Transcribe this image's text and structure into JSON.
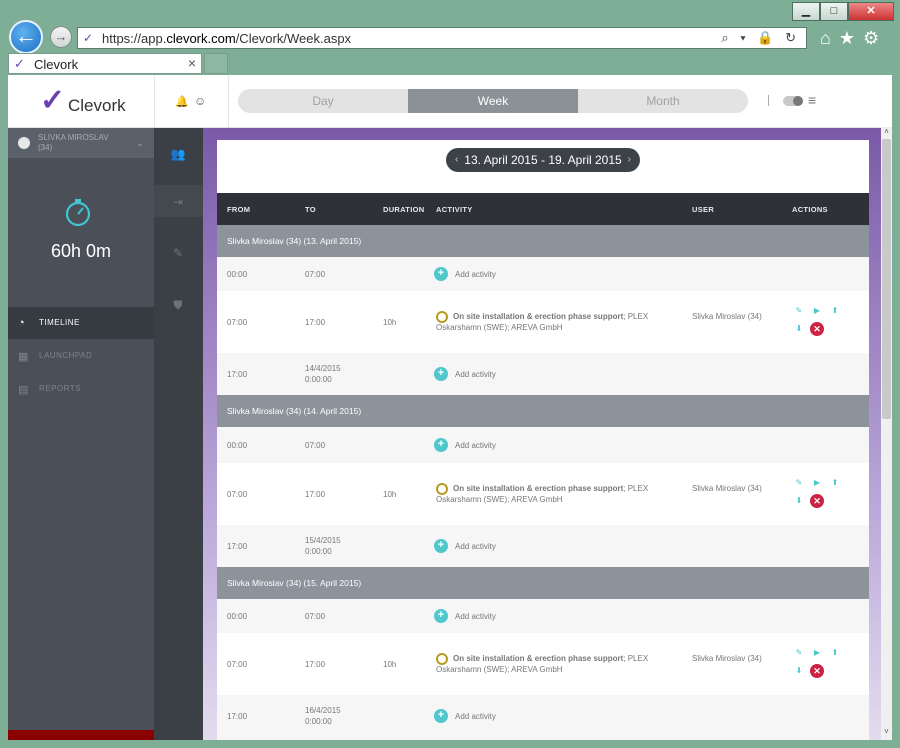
{
  "window": {
    "min": "▁",
    "max": "□",
    "close": "✕"
  },
  "browser": {
    "url_prefix": "https://app.",
    "url_domain": "clevork.com",
    "url_path": "/Clevork/Week.aspx",
    "tools": "⌕ ▾ 🔒 ↻",
    "icons": "⌂★⚙",
    "back": "←",
    "forward": "→"
  },
  "tab": {
    "title": "Clevork",
    "close": "×"
  },
  "header": {
    "logo_text": "Clevork",
    "logo_mark": "✓",
    "bell": "🔔",
    "smile": "☺",
    "views": [
      "Day",
      "Week",
      "Month"
    ],
    "active_view": "Week",
    "menu": "≡"
  },
  "sidebar": {
    "user_name": "SLIVKA MIROSLAV",
    "user_id": "(34)",
    "timer": "60h 0m",
    "nav": [
      {
        "label": "TIMELINE",
        "icon": "timeline-icon",
        "active": true
      },
      {
        "label": "LAUNCHPAD",
        "icon": "launchpad-icon",
        "active": false
      },
      {
        "label": "REPORTS",
        "icon": "reports-icon",
        "active": false
      }
    ]
  },
  "main": {
    "date_range": "13. April 2015 - 19. April 2015",
    "prev": "‹",
    "next": "›",
    "columns": {
      "from": "FROM",
      "to": "TO",
      "duration": "DURATION",
      "activity": "ACTIVITY",
      "user": "USER",
      "actions": "ACTIONS"
    },
    "groups": [
      {
        "title": "Slivka Miroslav (34) (13. April 2015)",
        "r1": {
          "from": "00:00",
          "to": "07:00",
          "add": "Add activity"
        },
        "r2": {
          "from": "07:00",
          "to": "17:00",
          "duration": "10h",
          "activity_bold": "On site installation & erection phase support",
          "activity_rest": "; PLEX Oskarshamn (SWE); AREVA GmbH",
          "user": "Slivka Miroslav (34)"
        },
        "r3": {
          "from": "17:00",
          "to": "14/4/2015 0:00:00",
          "add": "Add activity"
        }
      },
      {
        "title": "Slivka Miroslav (34) (14. April 2015)",
        "r1": {
          "from": "00:00",
          "to": "07:00",
          "add": "Add activity"
        },
        "r2": {
          "from": "07:00",
          "to": "17:00",
          "duration": "10h",
          "activity_bold": "On site installation & erection phase support",
          "activity_rest": "; PLEX Oskarshamn (SWE); AREVA GmbH",
          "user": "Slivka Miroslav (34)"
        },
        "r3": {
          "from": "17:00",
          "to": "15/4/2015 0:00:00",
          "add": "Add activity"
        }
      },
      {
        "title": "Slivka Miroslav (34) (15. April 2015)",
        "r1": {
          "from": "00:00",
          "to": "07:00",
          "add": "Add activity"
        },
        "r2": {
          "from": "07:00",
          "to": "17:00",
          "duration": "10h",
          "activity_bold": "On site installation & erection phase support",
          "activity_rest": "; PLEX Oskarshamn (SWE); AREVA GmbH",
          "user": "Slivka Miroslav (34)"
        },
        "r3": {
          "from": "17:00",
          "to": "16/4/2015 0:00:00",
          "add": "Add activity"
        }
      }
    ],
    "action_icons": {
      "edit": "✎",
      "play": "▶",
      "up": "⬆",
      "down": "⬇",
      "delete": "✕"
    }
  }
}
